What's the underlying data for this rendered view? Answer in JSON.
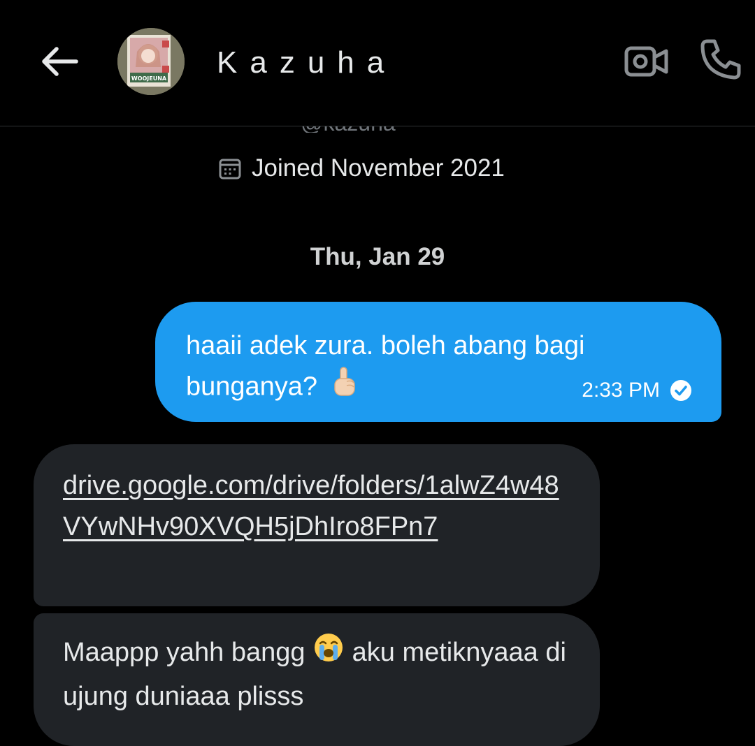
{
  "header": {
    "title": "Kazuha",
    "back_icon": "arrow-left-icon",
    "video_icon": "video-camera-icon",
    "call_icon": "phone-icon",
    "avatar_text": "WOOJEUNA"
  },
  "profile": {
    "handle": "@kazuha",
    "joined": "Joined November 2021",
    "calendar_icon": "calendar-icon"
  },
  "conversation": {
    "date_separator": "Thu, Jan 29",
    "messages": [
      {
        "direction": "outgoing",
        "text": "haaii adek zura. boleh abang bagi bunganya?",
        "emoji": "☝🏻",
        "time": "2:33 PM",
        "status_icon": "check-circle-icon"
      },
      {
        "direction": "incoming",
        "link": "drive.google.com/drive/folders/1alwZ4w48VYwNHv90XVQH5jDhIro8FPn7"
      },
      {
        "direction": "incoming",
        "text_before": "Maappp yahh bangg",
        "emoji": "😭",
        "text_after": "aku metiknyaaa di ujung duniaaa plisss"
      }
    ]
  },
  "colors": {
    "background": "#000000",
    "outgoing_bubble": "#1d9bf0",
    "incoming_bubble": "#202327",
    "text": "#e7e9ea",
    "muted": "#71767b"
  }
}
